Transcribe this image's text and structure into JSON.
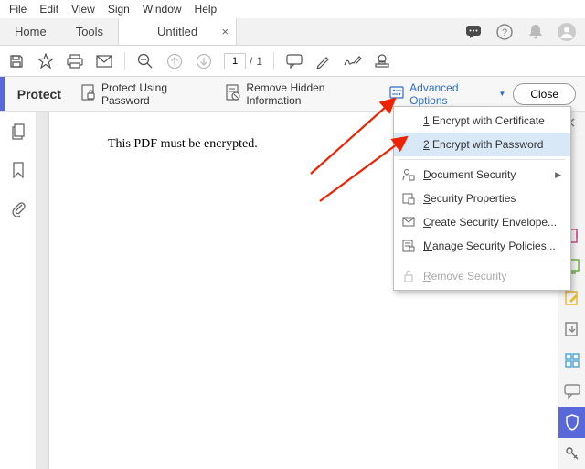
{
  "menubar": [
    "File",
    "Edit",
    "View",
    "Sign",
    "Window",
    "Help"
  ],
  "tabs": {
    "home": "Home",
    "tools": "Tools",
    "doc": "Untitled"
  },
  "toolbar": {
    "page_current": "1",
    "page_total": "1"
  },
  "protect": {
    "title": "Protect",
    "password_btn": "Protect Using Password",
    "remove_hidden_btn": "Remove Hidden Information",
    "advanced_btn": "Advanced Options",
    "close_btn": "Close"
  },
  "dropdown": {
    "encrypt_cert_num": "1",
    "encrypt_cert": "Encrypt with Certificate",
    "encrypt_pw_num": "2",
    "encrypt_pw": "Encrypt with Password",
    "doc_security": "Document Security",
    "sec_properties": "Security Properties",
    "create_envelope": "Create Security Envelope...",
    "manage_policies": "Manage Security Policies...",
    "remove_security": "Remove Security"
  },
  "document": {
    "body": "This PDF must be encrypted."
  }
}
